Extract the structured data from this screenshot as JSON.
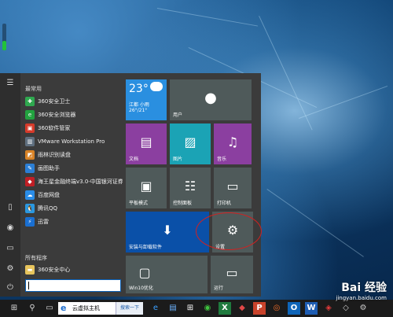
{
  "start_menu": {
    "header_frequent": "最常用",
    "header_all": "所有程序",
    "frequent_apps": [
      {
        "label": "360安全卫士",
        "icon": "shield-360-icon",
        "color": "#2fa84f",
        "glyph": "✚"
      },
      {
        "label": "360安全浏览器",
        "icon": "browser-360-icon",
        "color": "#22a33f",
        "glyph": "e"
      },
      {
        "label": "360软件管家",
        "icon": "software-manager-icon",
        "color": "#d63a2a",
        "glyph": "▣"
      },
      {
        "label": "VMware Workstation Pro",
        "icon": "vmware-icon",
        "color": "#5f6f7f",
        "glyph": "▥"
      },
      {
        "label": "雨林识别读盘",
        "icon": "disk-reader-icon",
        "color": "#d98326",
        "glyph": "◩"
      },
      {
        "label": "画图助手",
        "icon": "paint-helper-icon",
        "color": "#2b7fd6",
        "glyph": "✎"
      },
      {
        "label": "海王星金融终端v3.0-中国银河证券",
        "icon": "finance-terminal-icon",
        "color": "#c01f25",
        "glyph": "◆"
      },
      {
        "label": "百度网盘",
        "icon": "baidu-netdisk-icon",
        "color": "#2a8de8",
        "glyph": "☁"
      },
      {
        "label": "腾讯QQ",
        "icon": "qq-icon",
        "color": "#2a98e0",
        "glyph": "🐧"
      },
      {
        "label": "迅雷",
        "icon": "xunlei-icon",
        "color": "#1a6fd1",
        "glyph": "⚡"
      }
    ],
    "all_apps": [
      {
        "label": "360安全中心",
        "icon": "folder-icon",
        "color": "#e7c45c",
        "glyph": "▬"
      }
    ],
    "search_value": ""
  },
  "tiles": {
    "weather": {
      "temp": "23°",
      "city": "江都 小雨",
      "range": "26°/21°"
    },
    "user_label": "用户",
    "documents_label": "文档",
    "pictures_label": "图片",
    "music_label": "音乐",
    "tablet_mode_label": "平板模式",
    "control_panel_label": "控制面板",
    "printers_label": "打印机",
    "apps_uninstall_label": "安装与卸载软件",
    "settings_label": "设置",
    "win10_optimize_label": "Win10优化",
    "run_label": "运行"
  },
  "taskbar": {
    "search_query": "云虚拟主机",
    "search_button": "搜索一下"
  },
  "watermark": {
    "brand": "Bai 经验",
    "url": "jingyan.baidu.com"
  },
  "volume_level": 0.35,
  "colors": {
    "tile_blue": "#0a50a8",
    "tile_purple": "#8b3fa0",
    "tile_teal": "#1ba3b5",
    "tile_gray": "#4f5a5a",
    "weather_blue": "#2a8fe0",
    "annotation_red": "#d32020"
  }
}
